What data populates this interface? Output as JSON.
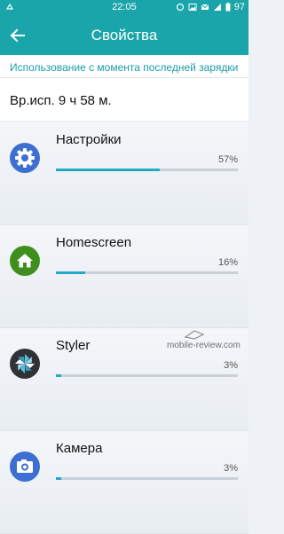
{
  "status_bar": {
    "time": "22:05",
    "battery": "97"
  },
  "header": {
    "title": "Свойства"
  },
  "section": {
    "heading": "Использование с момента последней зарядки"
  },
  "usage": {
    "time_text": "Вр.исп. 9 ч 58 м."
  },
  "apps": [
    {
      "name": "Настройки",
      "percent_text": "57%",
      "percent": 0.57,
      "icon": "settings-icon",
      "color": "#3c6fd1"
    },
    {
      "name": "Homescreen",
      "percent_text": "16%",
      "percent": 0.16,
      "icon": "home-icon",
      "color": "#3f8f1f"
    },
    {
      "name": "Styler",
      "percent_text": "3%",
      "percent": 0.03,
      "icon": "pinwheel-icon",
      "color": "#2f3336"
    },
    {
      "name": "Камера",
      "percent_text": "3%",
      "percent": 0.03,
      "icon": "camera-icon",
      "color": "#3c6fd1"
    }
  ],
  "watermark": {
    "text": "mobile-review.com"
  },
  "colors": {
    "accent": "#1aa5ab",
    "progress": "#23a9c4"
  }
}
